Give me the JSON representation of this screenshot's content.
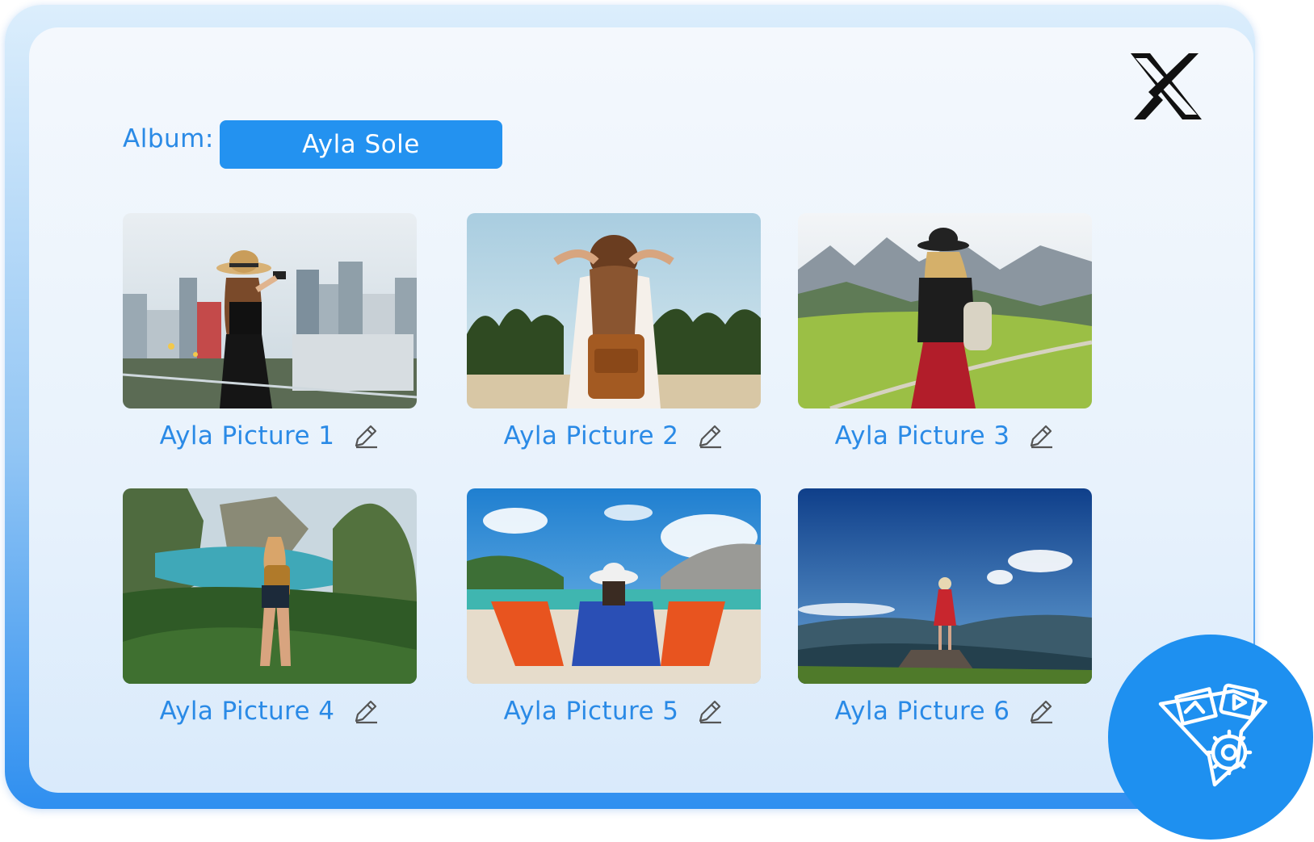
{
  "album": {
    "label": "Album:",
    "name": "Ayla Sole"
  },
  "pictures": [
    {
      "title": "Ayla Picture 1",
      "scene": "city-rooftop-photo"
    },
    {
      "title": "Ayla Picture 2",
      "scene": "tropical-beach-backpack"
    },
    {
      "title": "Ayla Picture 3",
      "scene": "mountain-valley-hat"
    },
    {
      "title": "Ayla Picture 4",
      "scene": "coastal-cliffs-hiker"
    },
    {
      "title": "Ayla Picture 5",
      "scene": "beach-deck-chairs"
    },
    {
      "title": "Ayla Picture 6",
      "scene": "mountain-summit-view"
    }
  ],
  "icons": {
    "close": "x-logo-icon",
    "edit": "pencil-icon",
    "fab": "media-funnel-settings-icon"
  },
  "colors": {
    "accent": "#2392f0",
    "text_accent": "#2a8ae6",
    "fab": "#1e90f0"
  }
}
